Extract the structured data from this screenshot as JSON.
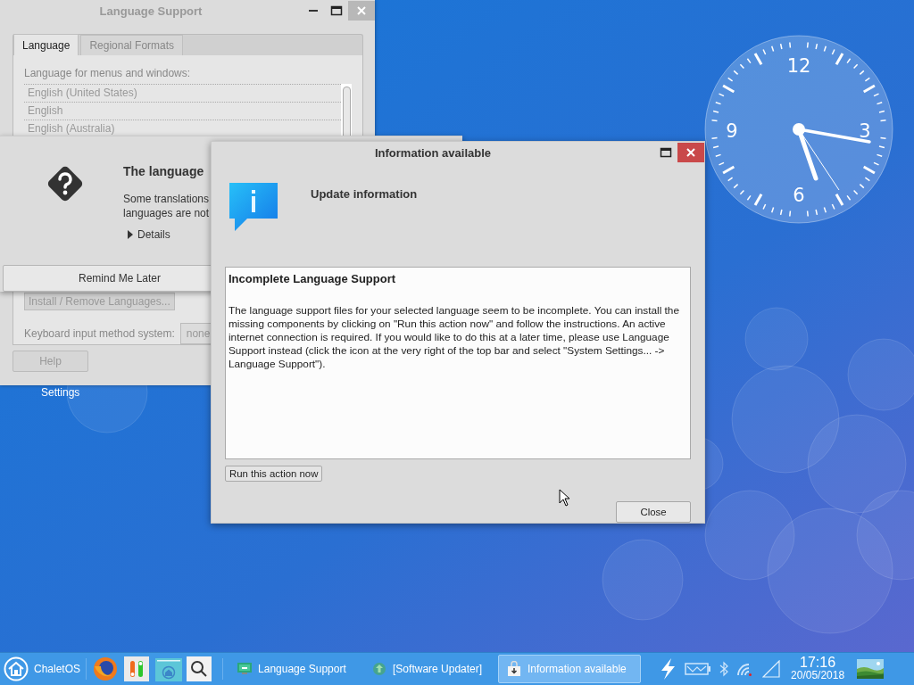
{
  "desktop": {
    "icon_label": "Settings"
  },
  "clock": {
    "numerals": [
      "12",
      "3",
      "6",
      "9"
    ]
  },
  "language_window": {
    "title": "Language Support",
    "active": false,
    "tabs": [
      {
        "label": "Language",
        "selected": true
      },
      {
        "label": "Regional Formats",
        "selected": false
      }
    ],
    "list_label": "Language for menus and windows:",
    "languages": [
      "English (United States)",
      "English",
      "English (Australia)"
    ],
    "install_button": "Install / Remove Languages...",
    "keyboard_label": "Keyboard input method system:",
    "keyboard_value": "none",
    "help_button": "Help"
  },
  "prompt_dialog": {
    "heading": "The language",
    "message_lines": [
      "Some translations",
      "languages are not"
    ],
    "details": "Details",
    "expanded": false,
    "button": "Remind Me Later"
  },
  "info_window": {
    "title": "Information available",
    "heading": "Update information",
    "message_title": "Incomplete Language Support",
    "message": "The language support files for your selected language seem to be incomplete. You can install the missing components by clicking on \"Run this action now\" and follow the instructions. An active internet connection is required. If you would like to do this at a later time, please use Language Support instead (click the icon at the very right of the top bar and select \"System Settings... -> Language Support\").",
    "action_button": "Run this action now",
    "close_button": "Close"
  },
  "taskbar": {
    "menu_label": "ChaletOS",
    "launchers": [
      {
        "kind": "firefox"
      },
      {
        "kind": "toggles"
      },
      {
        "kind": "home-folder"
      },
      {
        "kind": "search"
      }
    ],
    "tasks": [
      {
        "label": "Language Support",
        "kind": "monitor",
        "selected": false
      },
      {
        "label": "[Software Updater]",
        "kind": "update",
        "selected": false
      },
      {
        "label": "Information available",
        "kind": "package",
        "selected": true
      }
    ],
    "time": "17:16",
    "date": "20/05/2018"
  }
}
